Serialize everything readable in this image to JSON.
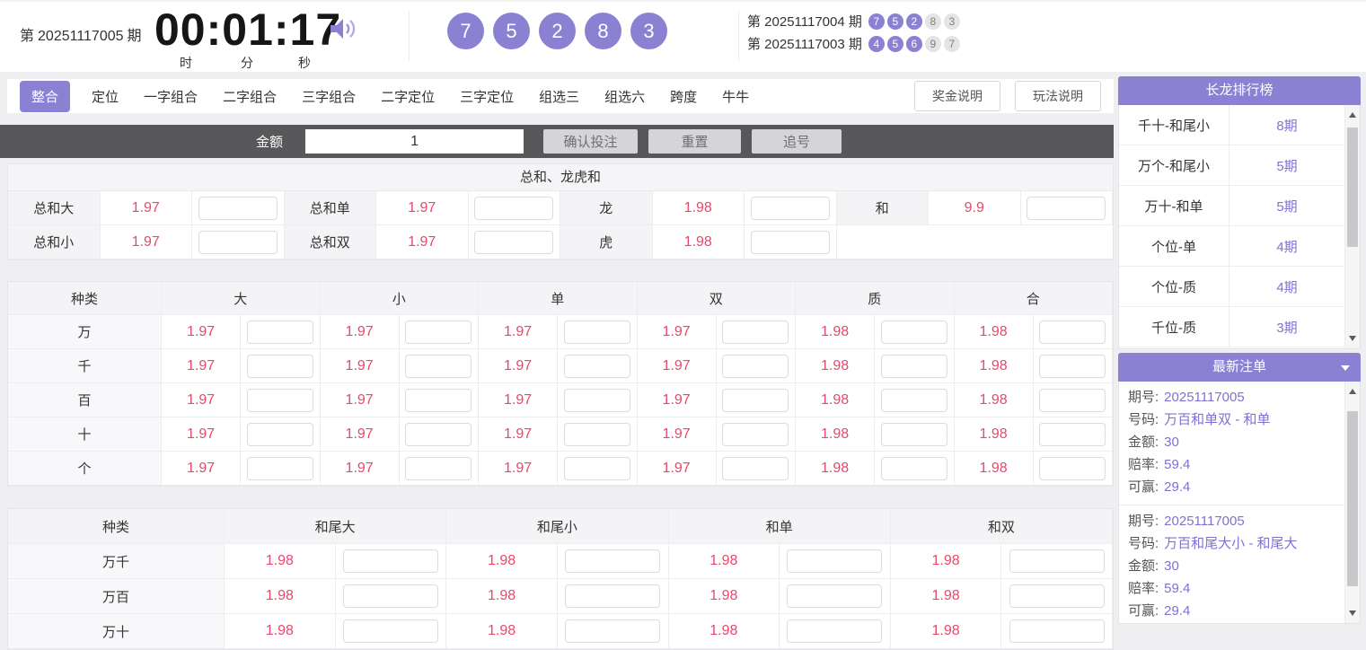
{
  "header": {
    "issue_prefix": "第",
    "issue_number": "20251117005",
    "issue_suffix": "期",
    "countdown": {
      "time": "00:01:17",
      "labels": [
        "时",
        "分",
        "秒"
      ]
    },
    "balls": [
      "7",
      "5",
      "2",
      "8",
      "3"
    ],
    "history": [
      {
        "prefix": "第",
        "issue": "20251117004",
        "suffix": "期",
        "balls": [
          "7",
          "5",
          "2",
          "8",
          "3"
        ],
        "highlight_count": 3
      },
      {
        "prefix": "第",
        "issue": "20251117003",
        "suffix": "期",
        "balls": [
          "4",
          "5",
          "6",
          "9",
          "7"
        ],
        "highlight_count": 3
      }
    ]
  },
  "nav": {
    "tabs": [
      {
        "label": "整合",
        "active": true
      },
      {
        "label": "定位",
        "active": false
      },
      {
        "label": "一字组合",
        "active": false
      },
      {
        "label": "二字组合",
        "active": false
      },
      {
        "label": "三字组合",
        "active": false
      },
      {
        "label": "二字定位",
        "active": false
      },
      {
        "label": "三字定位",
        "active": false
      },
      {
        "label": "组选三",
        "active": false
      },
      {
        "label": "组选六",
        "active": false
      },
      {
        "label": "跨度",
        "active": false
      },
      {
        "label": "牛牛",
        "active": false
      }
    ],
    "buttons": [
      "奖金说明",
      "玩法说明"
    ]
  },
  "bet_bar": {
    "amount_label": "金额",
    "amount_value": "1",
    "buttons": [
      "确认投注",
      "重置",
      "追号"
    ]
  },
  "sum_section": {
    "title": "总和、龙虎和",
    "rows": [
      [
        {
          "label": "总和大",
          "odds": "1.97"
        },
        {
          "label": "总和单",
          "odds": "1.97"
        },
        {
          "label": "龙",
          "odds": "1.98"
        },
        {
          "label": "和",
          "odds": "9.9"
        }
      ],
      [
        {
          "label": "总和小",
          "odds": "1.97"
        },
        {
          "label": "总和双",
          "odds": "1.97"
        },
        {
          "label": "虎",
          "odds": "1.98"
        },
        null
      ]
    ]
  },
  "position_table": {
    "type_header": "种类",
    "columns": [
      "大",
      "小",
      "单",
      "双",
      "质",
      "合"
    ],
    "rows": [
      {
        "label": "万",
        "odds": [
          "1.97",
          "1.97",
          "1.97",
          "1.97",
          "1.98",
          "1.98"
        ]
      },
      {
        "label": "千",
        "odds": [
          "1.97",
          "1.97",
          "1.97",
          "1.97",
          "1.98",
          "1.98"
        ]
      },
      {
        "label": "百",
        "odds": [
          "1.97",
          "1.97",
          "1.97",
          "1.97",
          "1.98",
          "1.98"
        ]
      },
      {
        "label": "十",
        "odds": [
          "1.97",
          "1.97",
          "1.97",
          "1.97",
          "1.98",
          "1.98"
        ]
      },
      {
        "label": "个",
        "odds": [
          "1.97",
          "1.97",
          "1.97",
          "1.97",
          "1.98",
          "1.98"
        ]
      }
    ]
  },
  "tail_table": {
    "type_header": "种类",
    "columns": [
      "和尾大",
      "和尾小",
      "和单",
      "和双"
    ],
    "rows": [
      {
        "label": "万千",
        "odds": [
          "1.98",
          "1.98",
          "1.98",
          "1.98"
        ]
      },
      {
        "label": "万百",
        "odds": [
          "1.98",
          "1.98",
          "1.98",
          "1.98"
        ]
      },
      {
        "label": "万十",
        "odds": [
          "1.98",
          "1.98",
          "1.98",
          "1.98"
        ]
      }
    ]
  },
  "dragon_panel": {
    "title": "长龙排行榜",
    "items": [
      {
        "name": "千十-和尾小",
        "count": "8期"
      },
      {
        "name": "万个-和尾小",
        "count": "5期"
      },
      {
        "name": "万十-和单",
        "count": "5期"
      },
      {
        "name": "个位-单",
        "count": "4期"
      },
      {
        "name": "个位-质",
        "count": "4期"
      },
      {
        "name": "千位-质",
        "count": "3期"
      }
    ]
  },
  "orders_panel": {
    "title": "最新注单",
    "field_labels": {
      "issue": "期号:",
      "number": "号码:",
      "amount": "金额:",
      "odds": "赔率:",
      "win": "可赢:"
    },
    "entries": [
      {
        "issue": "20251117005",
        "number": "万百和单双 - 和单",
        "amount": "30",
        "odds": "59.4",
        "win": "29.4"
      },
      {
        "issue": "20251117005",
        "number": "万百和尾大小 - 和尾大",
        "amount": "30",
        "odds": "59.4",
        "win": "29.4"
      }
    ]
  },
  "colors": {
    "accent_purple": "#8b81d3",
    "value_purple": "#7d72d2",
    "odds_red": "#e9486b",
    "bar_dark": "#58585a"
  }
}
